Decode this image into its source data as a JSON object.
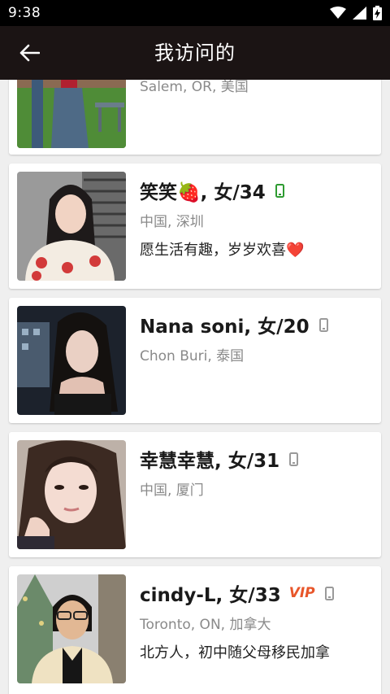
{
  "status_bar": {
    "time": "9:38",
    "icons": [
      "wifi-icon",
      "signal-icon",
      "battery-charging-icon"
    ]
  },
  "app_bar": {
    "title": "我访问的",
    "back_icon": "arrow-left-icon"
  },
  "colors": {
    "app_bar": "#1b1414",
    "status_bar": "#000000",
    "vip": "#e8562a",
    "phone_active": "#2e9b31",
    "phone_inactive": "#9a9a9a"
  },
  "cards": [
    {
      "name": "",
      "location": "Salem, OR, 美国",
      "bio": "",
      "phone": "none",
      "vip": ""
    },
    {
      "name": "笑笑🍓, 女/34",
      "location": "中国, 深圳",
      "bio": "愿生活有趣，岁岁欢喜❤️",
      "phone": "active",
      "vip": ""
    },
    {
      "name": "Nana soni, 女/20",
      "location": "Chon Buri, 泰国",
      "bio": "",
      "phone": "inactive",
      "vip": ""
    },
    {
      "name": "幸慧幸慧, 女/31",
      "location": "中国, 厦门",
      "bio": "",
      "phone": "inactive",
      "vip": ""
    },
    {
      "name": "cindy-L, 女/33",
      "location": "Toronto, ON, 加拿大",
      "bio": "北方人，初中随父母移民加拿",
      "phone": "inactive",
      "vip": "VIP"
    }
  ]
}
